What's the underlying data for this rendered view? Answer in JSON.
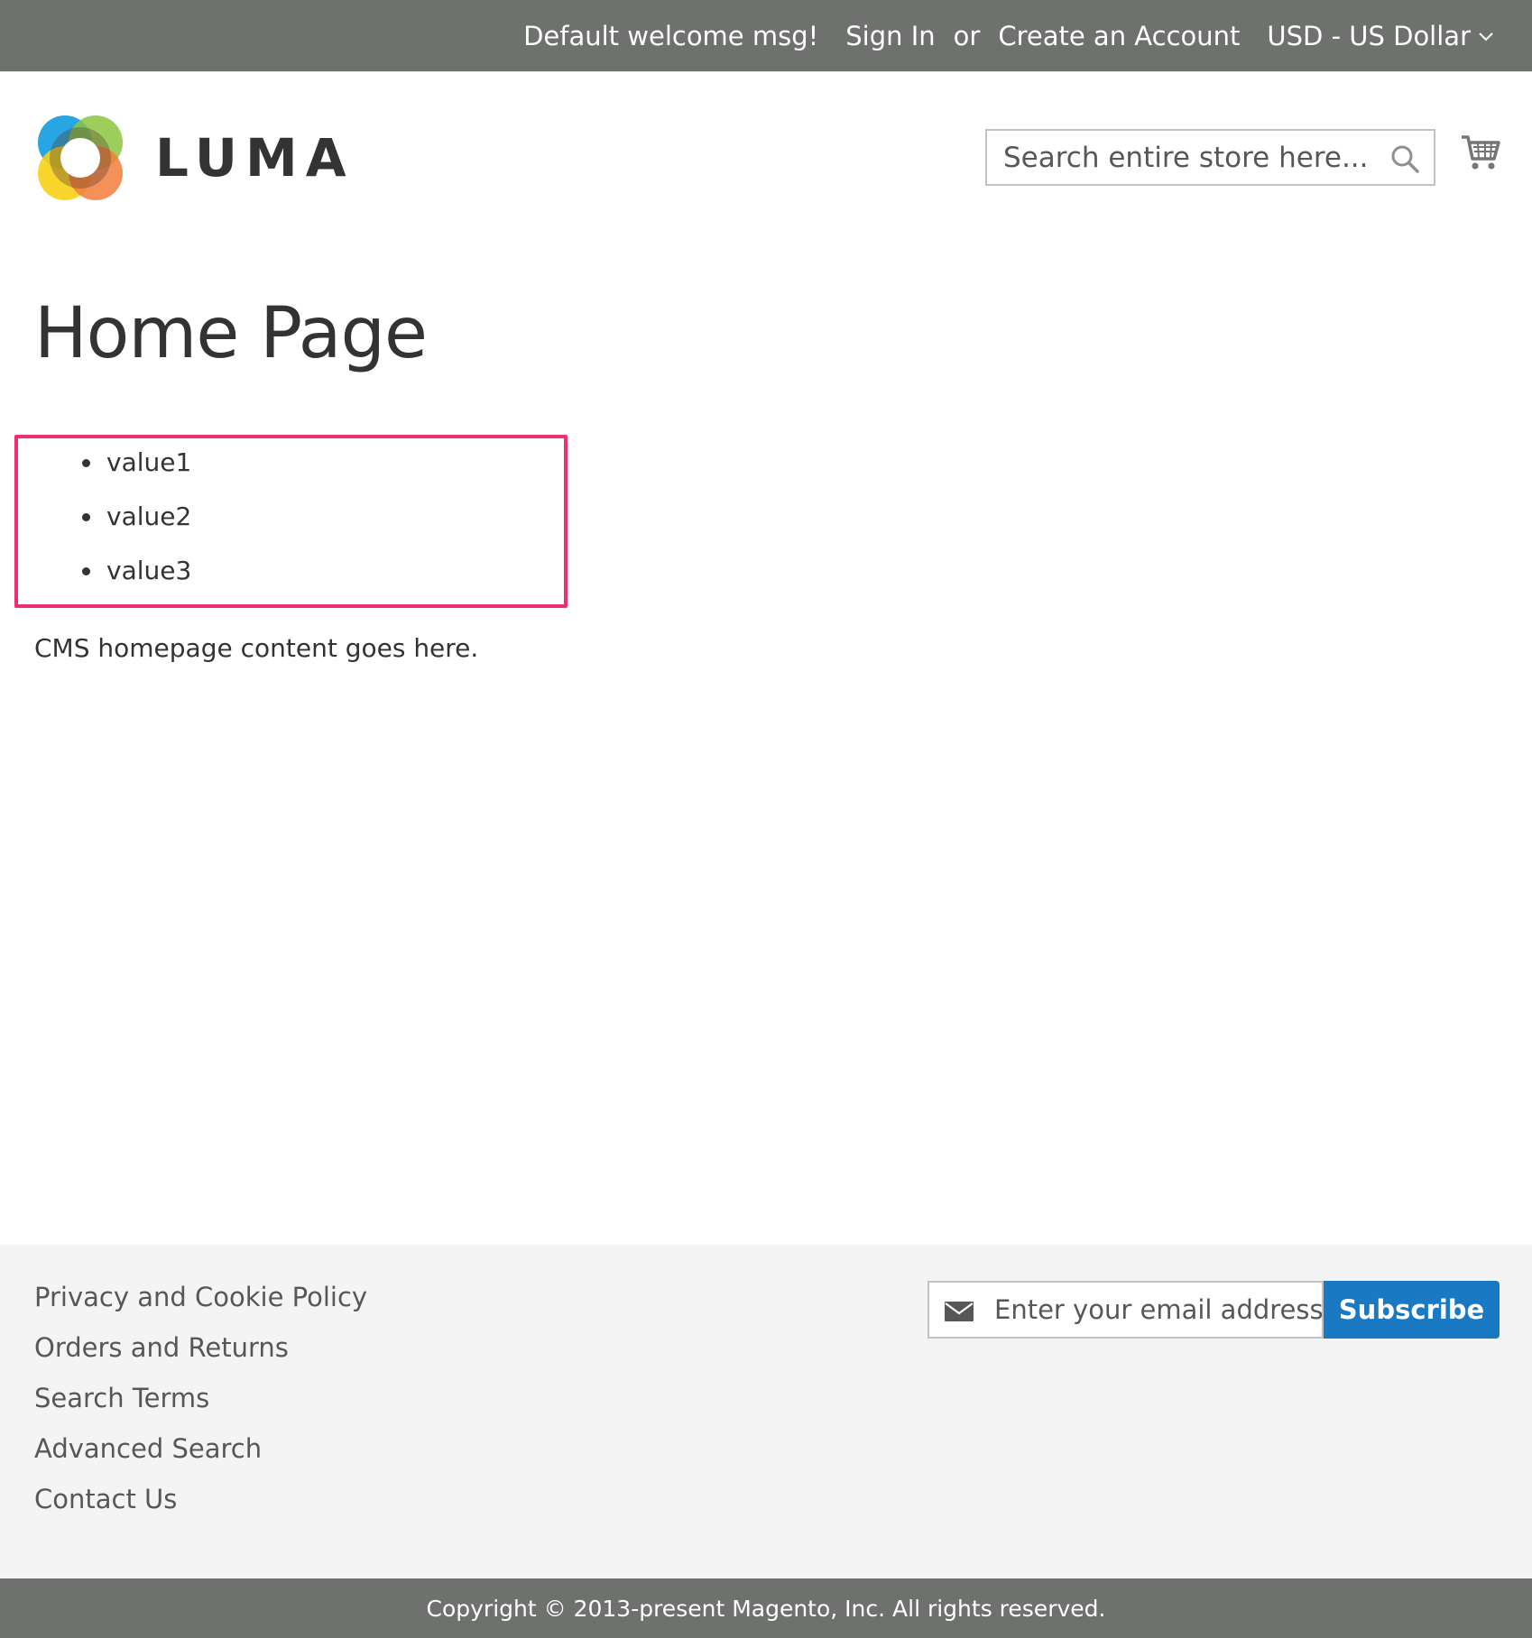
{
  "header_panel": {
    "welcome": "Default welcome msg!",
    "sign_in": "Sign In",
    "or": "or",
    "create_account": "Create an Account",
    "currency": "USD - US Dollar",
    "currency_icon": "chevron-down-icon"
  },
  "header": {
    "logo_text": "LUMA",
    "search": {
      "placeholder": "Search entire store here...",
      "value": "",
      "icon": "search-icon"
    },
    "cart_icon": "cart-icon"
  },
  "main": {
    "page_title": "Home Page",
    "list_items": [
      "value1",
      "value2",
      "value3"
    ],
    "highlight_color": "#f0306d",
    "cms_text": "CMS homepage content goes here."
  },
  "footer": {
    "links": [
      "Privacy and Cookie Policy",
      "Orders and Returns",
      "Search Terms",
      "Advanced Search",
      "Contact Us"
    ],
    "newsletter": {
      "placeholder": "Enter your email address",
      "value": "",
      "icon": "envelope-icon",
      "button": "Subscribe"
    },
    "copyright": "Copyright © 2013-present Magento, Inc. All rights reserved."
  },
  "colors": {
    "panel_bg": "#6e716e",
    "footer_bg": "#f4f4f4",
    "accent": "#1979c3"
  }
}
